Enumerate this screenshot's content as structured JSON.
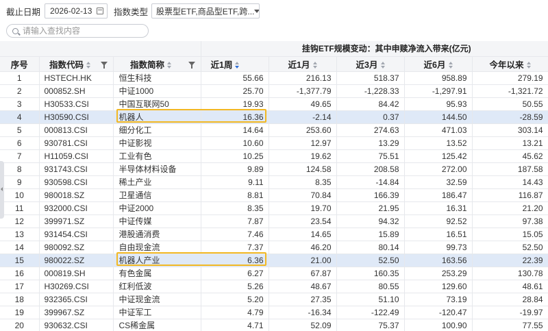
{
  "toolbar": {
    "date_label": "截止日期",
    "date_value": "2026-02-13",
    "type_label": "指数类型",
    "type_value": "股票型ETF,商品型ETF,跨..."
  },
  "search": {
    "placeholder": "请输入查找内容"
  },
  "table": {
    "group_header": "挂钩ETF规模变动：其中申赎净流入带来(亿元)",
    "headers": {
      "seq": "序号",
      "code": "指数代码",
      "name": "指数简称",
      "w1": "近1周",
      "m1": "近1月",
      "m3": "近3月",
      "m6": "近6月",
      "ytd": "今年以来"
    },
    "rows": [
      {
        "seq": "1",
        "code": "HSTECH.HK",
        "name": "恒生科技",
        "w1": "55.66",
        "m1": "216.13",
        "m3": "518.37",
        "m6": "958.89",
        "ytd": "279.19"
      },
      {
        "seq": "2",
        "code": "000852.SH",
        "name": "中证1000",
        "w1": "25.70",
        "m1": "-1,377.79",
        "m3": "-1,228.33",
        "m6": "-1,297.91",
        "ytd": "-1,321.72"
      },
      {
        "seq": "3",
        "code": "H30533.CSI",
        "name": "中国互联网50",
        "w1": "19.93",
        "m1": "49.65",
        "m3": "84.42",
        "m6": "95.93",
        "ytd": "50.55"
      },
      {
        "seq": "4",
        "code": "H30590.CSI",
        "name": "机器人",
        "w1": "16.36",
        "m1": "-2.14",
        "m3": "0.37",
        "m6": "144.50",
        "ytd": "-28.59"
      },
      {
        "seq": "5",
        "code": "000813.CSI",
        "name": "细分化工",
        "w1": "14.64",
        "m1": "253.60",
        "m3": "274.63",
        "m6": "471.03",
        "ytd": "303.14"
      },
      {
        "seq": "6",
        "code": "930781.CSI",
        "name": "中证影视",
        "w1": "10.60",
        "m1": "12.97",
        "m3": "13.29",
        "m6": "13.52",
        "ytd": "13.21"
      },
      {
        "seq": "7",
        "code": "H11059.CSI",
        "name": "工业有色",
        "w1": "10.25",
        "m1": "19.62",
        "m3": "75.51",
        "m6": "125.42",
        "ytd": "45.62"
      },
      {
        "seq": "8",
        "code": "931743.CSI",
        "name": "半导体材料设备",
        "w1": "9.89",
        "m1": "124.58",
        "m3": "208.58",
        "m6": "272.00",
        "ytd": "187.58"
      },
      {
        "seq": "9",
        "code": "930598.CSI",
        "name": "稀土产业",
        "w1": "9.11",
        "m1": "8.35",
        "m3": "-14.84",
        "m6": "32.59",
        "ytd": "14.43"
      },
      {
        "seq": "10",
        "code": "980018.SZ",
        "name": "卫星通信",
        "w1": "8.81",
        "m1": "70.84",
        "m3": "166.39",
        "m6": "186.47",
        "ytd": "116.87"
      },
      {
        "seq": "11",
        "code": "932000.CSI",
        "name": "中证2000",
        "w1": "8.35",
        "m1": "19.70",
        "m3": "21.95",
        "m6": "16.31",
        "ytd": "21.20"
      },
      {
        "seq": "12",
        "code": "399971.SZ",
        "name": "中证传媒",
        "w1": "7.87",
        "m1": "23.54",
        "m3": "94.32",
        "m6": "92.52",
        "ytd": "97.38"
      },
      {
        "seq": "13",
        "code": "931454.CSI",
        "name": "港股通消费",
        "w1": "7.46",
        "m1": "14.65",
        "m3": "15.89",
        "m6": "16.51",
        "ytd": "15.05"
      },
      {
        "seq": "14",
        "code": "980092.SZ",
        "name": "自由现金流",
        "w1": "7.37",
        "m1": "46.20",
        "m3": "80.14",
        "m6": "99.73",
        "ytd": "52.50"
      },
      {
        "seq": "15",
        "code": "980022.SZ",
        "name": "机器人产业",
        "w1": "6.36",
        "m1": "21.00",
        "m3": "52.50",
        "m6": "163.56",
        "ytd": "22.39"
      },
      {
        "seq": "16",
        "code": "000819.SH",
        "name": "有色金属",
        "w1": "6.27",
        "m1": "67.87",
        "m3": "160.35",
        "m6": "253.29",
        "ytd": "130.78"
      },
      {
        "seq": "17",
        "code": "H30269.CSI",
        "name": "红利低波",
        "w1": "5.26",
        "m1": "48.67",
        "m3": "80.55",
        "m6": "129.60",
        "ytd": "48.61"
      },
      {
        "seq": "18",
        "code": "932365.CSI",
        "name": "中证现金流",
        "w1": "5.20",
        "m1": "27.35",
        "m3": "51.10",
        "m6": "73.19",
        "ytd": "28.84"
      },
      {
        "seq": "19",
        "code": "399967.SZ",
        "name": "中证军工",
        "w1": "4.79",
        "m1": "-16.34",
        "m3": "-122.49",
        "m6": "-120.47",
        "ytd": "-19.97"
      },
      {
        "seq": "20",
        "code": "930632.CSI",
        "name": "CS稀金属",
        "w1": "4.71",
        "m1": "52.09",
        "m3": "75.37",
        "m6": "100.90",
        "ytd": "77.55"
      }
    ]
  }
}
